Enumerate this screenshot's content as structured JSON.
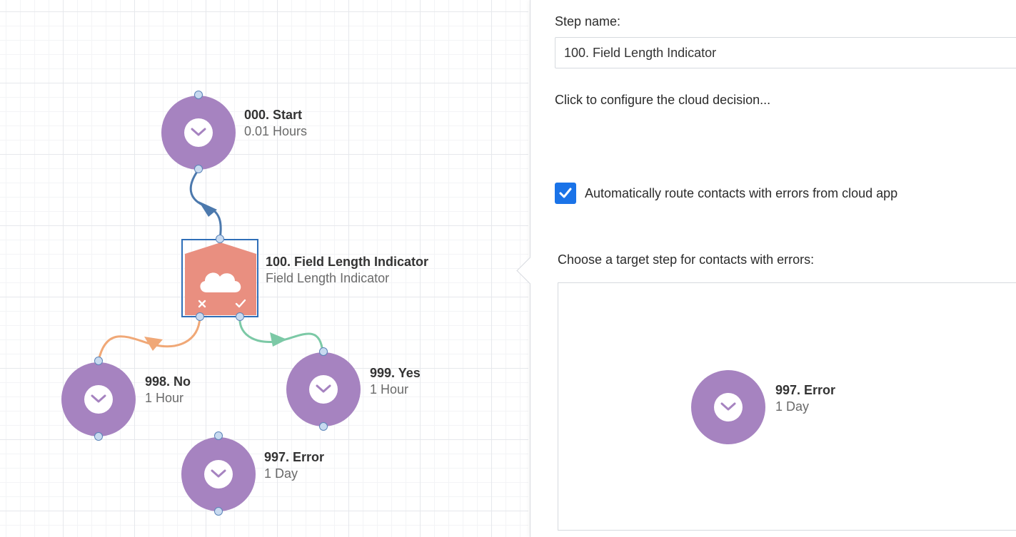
{
  "canvas": {
    "nodes": {
      "start": {
        "title": "000. Start",
        "subtitle": "0.01 Hours"
      },
      "decision": {
        "title": "100. Field Length Indicator",
        "subtitle": "Field Length Indicator"
      },
      "no": {
        "title": "998. No",
        "subtitle": "1 Hour"
      },
      "yes": {
        "title": "999. Yes",
        "subtitle": "1 Hour"
      },
      "error": {
        "title": "997. Error",
        "subtitle": "1 Day"
      }
    },
    "colors": {
      "wait_node": "#a683c0",
      "decision_node": "#e98f80",
      "selection": "#2f6fb8",
      "link_main": "#4c79ad",
      "link_no": "#f0a877",
      "link_yes": "#7cc9a6"
    }
  },
  "panel": {
    "step_name_label": "Step name:",
    "step_name_value": "100. Field Length Indicator",
    "configure_link": "Click to configure the cloud decision...",
    "auto_route_label": "Automatically route contacts with errors from cloud app",
    "auto_route_checked": true,
    "target_label": "Choose a target step for contacts with errors:",
    "target_node": {
      "title": "997. Error",
      "subtitle": "1 Day"
    },
    "checkbox_color": "#1a73e8"
  }
}
